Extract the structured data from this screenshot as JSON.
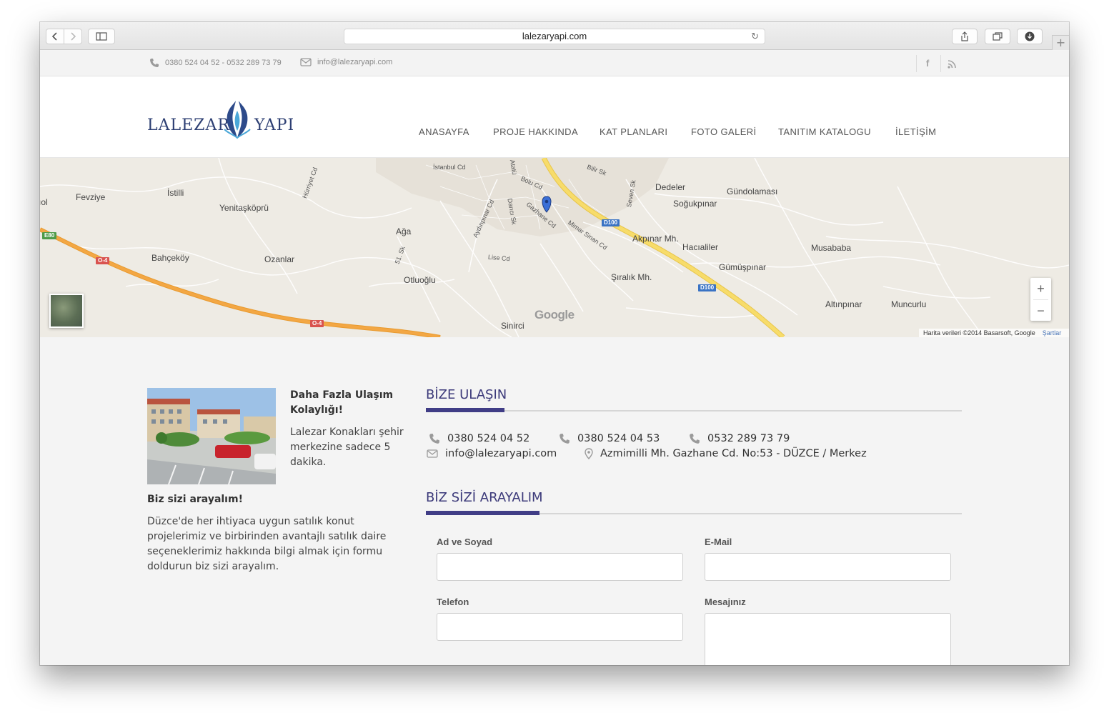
{
  "browser": {
    "url": "lalezaryapi.com",
    "back_icon": "chevron-left-icon",
    "forward_icon": "chevron-right-icon",
    "sidebar_icon": "sidebar-icon",
    "reload_icon": "reload-icon",
    "share_icon": "share-icon",
    "tabs_icon": "tabs-icon",
    "download_icon": "download-icon",
    "newtab_label": "+"
  },
  "topbar": {
    "phones": "0380 524 04 52 - 0532 289 73 79",
    "email": "info@lalezaryapi.com",
    "facebook_label": "f",
    "rss_icon": "rss-icon"
  },
  "header": {
    "logo_left": "LALEZAR",
    "logo_right": "YAPI",
    "nav": [
      "ANASAYFA",
      "PROJE HAKKINDA",
      "KAT PLANLARI",
      "FOTO GALERİ",
      "TANITIM KATALOGU",
      "İLETİŞİM"
    ]
  },
  "map": {
    "places": [
      "Fevziye",
      "İstilli",
      "Yenitaşköprü",
      "Ağa",
      "Bahçeköy",
      "Ozanlar",
      "Otluoğlu",
      "Sinirci",
      "Dedeler",
      "Gündolaması",
      "Soğukpınar",
      "Akpınar Mh.",
      "Hacıaliler",
      "Musababa",
      "Gümüşpınar",
      "Şıralık Mh.",
      "Altınpınar",
      "Muncurlu",
      "ıol"
    ],
    "streets": [
      "İstanbul Cd",
      "Bolu Cd",
      "Bilir Sk",
      "Hürriyet Cd",
      "Aydınpınar Cd",
      "Darıcı Sk",
      "Gazhane Cd",
      "Mimar Sinan Cd",
      "Lise Cd",
      "51. Sk",
      "Seven Sk",
      "Atatü"
    ],
    "shields": [
      "E80",
      "O-4",
      "O-4",
      "D100",
      "D100"
    ],
    "zoom_in": "+",
    "zoom_out": "−",
    "watermark": "Google",
    "attribution": "Harita verileri ©2014 Basarsoft, Google",
    "terms": "Şartlar"
  },
  "sidebar": {
    "promo_title_1": "Daha Fazla Ulaşım",
    "promo_title_2": "Kolaylığı!",
    "promo_text_1": "Lalezar Konakları şehir",
    "promo_text_2": "merkezine sadece 5",
    "promo_text_3": "dakika.",
    "callback_title": "Biz sizi arayalım!",
    "callback_text_1": "Düzce'de her ihtiyaca uygun satılık konut",
    "callback_text_2": "projelerimiz ve birbirinden avantajlı satılık daire",
    "callback_text_3": "seçeneklerimiz hakkında bilgi almak için formu",
    "callback_text_4": "doldurun biz sizi arayalım."
  },
  "contact": {
    "title": "BİZE ULAŞIN",
    "phone1": "0380 524 04 52",
    "phone2": "0380 524 04 53",
    "phone3": "0532 289 73 79",
    "email": "info@lalezaryapi.com",
    "address": "Azmimilli Mh. Gazhane Cd. No:53 - DÜZCE / Merkez"
  },
  "form": {
    "title": "BİZ SİZİ ARAYALIM",
    "name_label": "Ad ve Soyad",
    "email_label": "E-Mail",
    "phone_label": "Telefon",
    "message_label": "Mesajınız",
    "name_value": "",
    "email_value": "",
    "phone_value": "",
    "message_value": ""
  },
  "colors": {
    "accent": "#403d86",
    "logo_blue": "#2d3f73",
    "highway": "#f0a23a",
    "main_road": "#f4d35c"
  }
}
